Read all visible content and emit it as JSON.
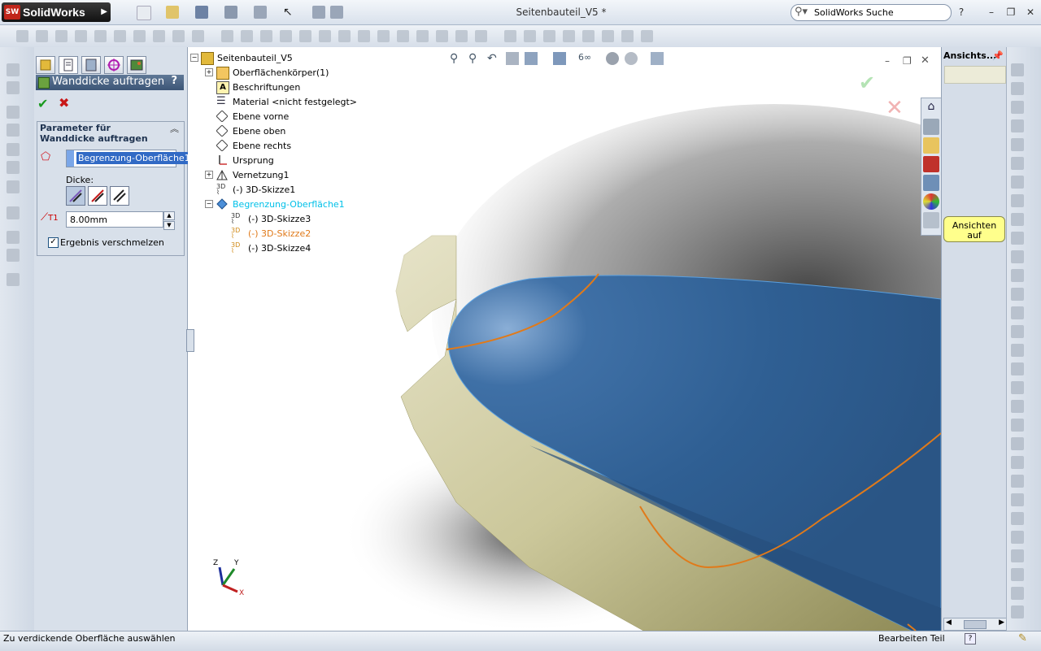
{
  "app": {
    "name": "SolidWorks",
    "logo_badge": "SW"
  },
  "window": {
    "title": "Seitenbauteil_V5 *"
  },
  "search": {
    "label": "SolidWorks Suche",
    "help": "?"
  },
  "property_manager": {
    "title": "Wanddicke auftragen",
    "help": "?",
    "group_title": "Parameter für Wanddicke auftragen",
    "selected_surface": "Begrenzung-Oberfläche1",
    "thickness_label": "Dicke:",
    "thickness_value": "8.00mm",
    "thickness_symbol": "T1",
    "merge_label": "Ergebnis verschmelzen",
    "merge_checked": true
  },
  "tree": {
    "root": "Seitenbauteil_V5",
    "items": [
      {
        "label": "Oberflächenkörper(1)",
        "icon": "surface-bodies-folder-icon"
      },
      {
        "label": "Beschriftungen",
        "icon": "annotations-icon"
      },
      {
        "label": "Material <nicht festgelegt>",
        "icon": "material-icon"
      },
      {
        "label": "Ebene vorne",
        "icon": "plane-icon"
      },
      {
        "label": "Ebene oben",
        "icon": "plane-icon"
      },
      {
        "label": "Ebene rechts",
        "icon": "plane-icon"
      },
      {
        "label": "Ursprung",
        "icon": "origin-icon"
      },
      {
        "label": "Vernetzung1",
        "icon": "mesh-icon"
      },
      {
        "label": "(-) 3D-Skizze1",
        "icon": "3d-sketch-icon"
      },
      {
        "label": "Begrenzung-Oberfläche1",
        "icon": "boundary-surface-icon"
      },
      {
        "label": "(-) 3D-Skizze3",
        "icon": "3d-sketch-icon"
      },
      {
        "label": "(-) 3D-Skizze2",
        "icon": "3d-sketch-icon"
      },
      {
        "label": "(-) 3D-Skizze4",
        "icon": "3d-sketch-icon"
      }
    ]
  },
  "taskpane": {
    "title": "Ansichts...",
    "tooltip_line1": "Ansichten",
    "tooltip_line2": "auf"
  },
  "triad": {
    "x": "X",
    "y": "Y",
    "z": "Z"
  },
  "status": {
    "message": "Zu verdickende Oberfläche auswählen",
    "mode": "Bearbeiten Teil"
  },
  "colors": {
    "surface_blue": "#2f5f93",
    "curve_orange": "#e07a1a",
    "selection_cyan": "#00c0e8",
    "ok_green": "#1a9a20",
    "cancel_red": "#c81818"
  }
}
